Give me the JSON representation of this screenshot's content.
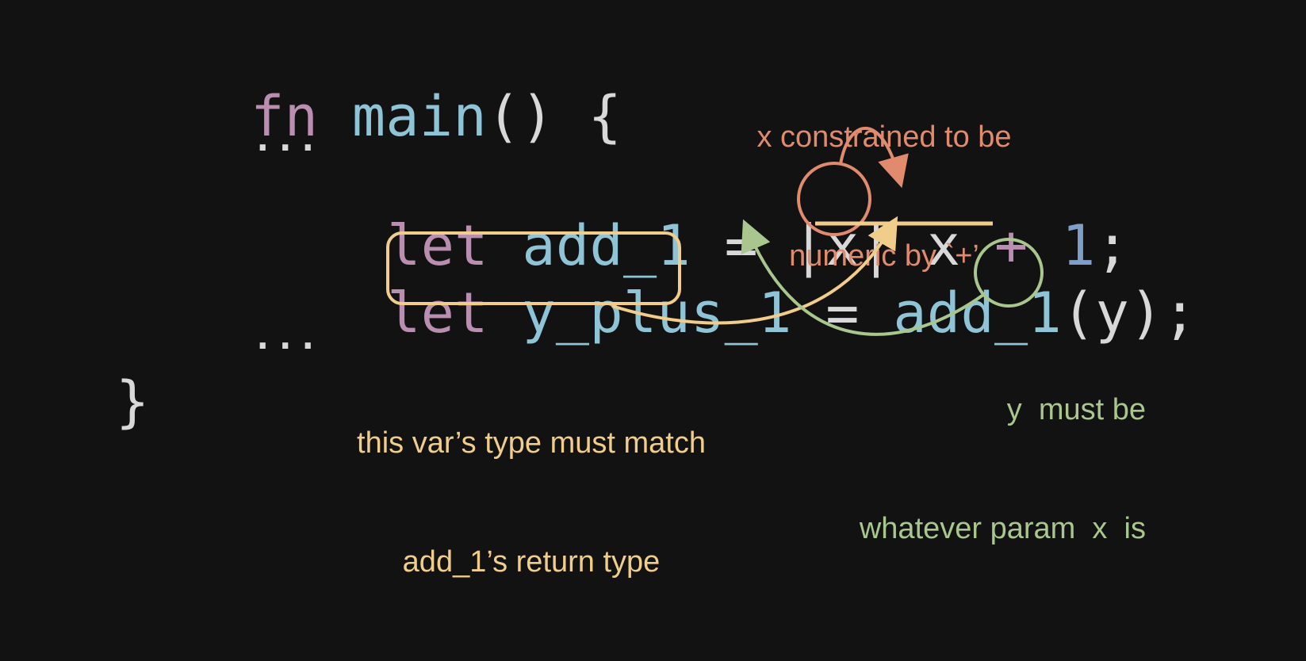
{
  "code": {
    "line1": {
      "kw": "fn",
      "name": "main",
      "rest": "() {"
    },
    "ellipsis_top": "...",
    "line_let1": {
      "kw": "let",
      "name": "add_1",
      "eq": "=",
      "pipe_open": "|",
      "param": "x",
      "pipe_close": "|",
      "body_x": "x",
      "plus": "+",
      "one": "1",
      "semi": ";"
    },
    "line_let2": {
      "kw": "let",
      "name": "y_plus_1",
      "eq": "=",
      "call": "add_1",
      "paren_open": "(",
      "arg": "y",
      "paren_close": ")",
      "semi": ";"
    },
    "ellipsis_bottom": "...",
    "close_brace": "}"
  },
  "notes": {
    "numeric": {
      "line1": "x constrained to be",
      "line2": "numeric by `+’"
    },
    "return_type": {
      "line1": "this var’s type must match",
      "line2": "add_1’s return type"
    },
    "param": {
      "line1": "y  must be",
      "line2": "whatever param  x  is"
    }
  },
  "colors": {
    "background": "#121212",
    "keyword": "#b98eb0",
    "identifier": "#8fc3d6",
    "plain": "#d8d8d8",
    "number": "#7f9fc9",
    "annotation_orange": "#e08a6e",
    "annotation_yellow": "#f0cd8a",
    "annotation_green": "#a8c68e"
  }
}
